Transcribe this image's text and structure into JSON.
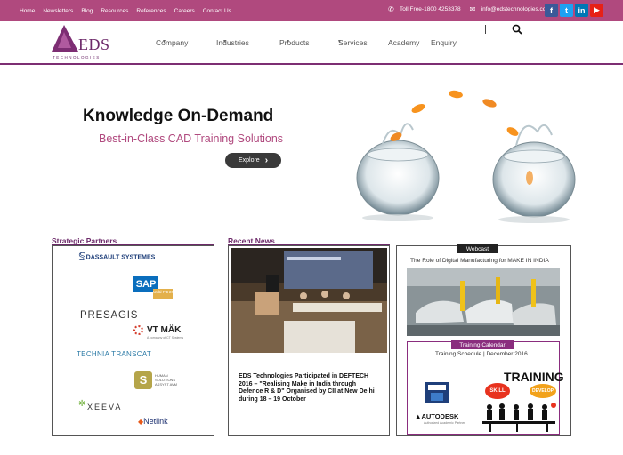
{
  "topbar": {
    "links": [
      "Home",
      "Newsletters",
      "Blog",
      "Resources",
      "References",
      "Careers",
      "Contact Us"
    ],
    "phone": "Toll Free-1800 4253378",
    "email": "info@edstechnologies.com",
    "colors": {
      "background": "#b0497e",
      "text": "#ffffff"
    }
  },
  "social": [
    {
      "icon": "facebook-icon",
      "label": "f",
      "color": "#3b5998"
    },
    {
      "icon": "twitter-icon",
      "label": "t",
      "color": "#1da1f2"
    },
    {
      "icon": "linkedin-icon",
      "label": "in",
      "color": "#0077b5"
    },
    {
      "icon": "youtube-icon",
      "label": "▶",
      "color": "#e62117"
    }
  ],
  "logo": {
    "name": "EDS",
    "sub": "TECHNOLOGIES"
  },
  "nav": {
    "items": [
      {
        "label": "Company",
        "caret": "▾"
      },
      {
        "label": "Industries",
        "caret": "▾"
      },
      {
        "label": "Products",
        "caret": "▾"
      },
      {
        "label": "Services",
        "caret": "▾"
      },
      {
        "label": "Academy",
        "caret": ""
      },
      {
        "label": "Enquiry",
        "caret": ""
      }
    ]
  },
  "hero": {
    "title": "Knowledge On-Demand",
    "subtitle": "Best-in-Class CAD Training Solutions",
    "button": "Explore",
    "button_icon": "›"
  },
  "partners": {
    "title": "Strategic Partners",
    "logos": [
      {
        "text": "DASSAULT SYSTEMES",
        "color": "#1f3f7a"
      },
      {
        "text": "SAP",
        "sub": "Gold Partner",
        "color": "#0a6ebd"
      },
      {
        "text": "PRESAGIS",
        "color": "#333333"
      },
      {
        "text": "VT MÄK",
        "sub": "A company of CT Systems",
        "color": "#222222"
      },
      {
        "text": "TECHNIA TRANSCAT",
        "color": "#2b7aa6"
      },
      {
        "text": "HUMAN SOLUTIONS ASSYST AVM",
        "color": "#555555"
      },
      {
        "text": "XEEVA",
        "color": "#333333"
      },
      {
        "text": "Netlink",
        "color": "#1a2e6e"
      }
    ]
  },
  "news": {
    "title": "Recent News",
    "headline": "EDS Technologies Participated in DEFTECH 2016 – \"Realising Make in India through Defence R & D\" Organised by CII at New Delhi during 18 – 19 October"
  },
  "webcast": {
    "badge": "Webcast",
    "title": "The Role of Digital Manufacturing for MAKE IN INDIA",
    "calendar_badge": "Training Calendar",
    "schedule": "Training Schedule | December 2016",
    "training_word": "TRAINING",
    "skill": "SKILL",
    "develop": "DEVELOP",
    "autodesk": "AUTODESK",
    "autodesk_sub": "Authorized Academic Partner"
  }
}
